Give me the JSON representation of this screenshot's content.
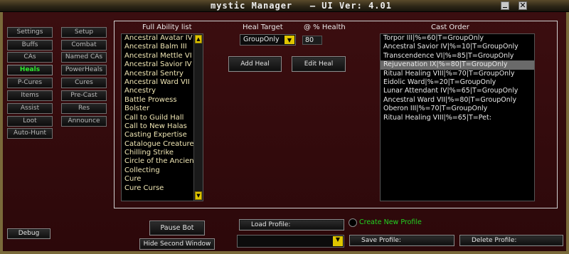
{
  "window": {
    "title": "mystic Manager   — UI Ver: 4.01",
    "close_glyph": "✕"
  },
  "sidebar": {
    "left": [
      {
        "label": "Settings",
        "active": false
      },
      {
        "label": "Buffs",
        "active": false
      },
      {
        "label": "CAs",
        "active": false
      },
      {
        "label": "Heals",
        "active": true
      },
      {
        "label": "P-Cures",
        "active": false
      },
      {
        "label": "Items",
        "active": false
      },
      {
        "label": "Assist",
        "active": false
      },
      {
        "label": "Loot",
        "active": false
      },
      {
        "label": "Auto-Hunt",
        "active": false
      }
    ],
    "right": [
      {
        "label": "Setup"
      },
      {
        "label": "Combat"
      },
      {
        "label": "Named CAs"
      },
      {
        "label": "PowerHeals"
      },
      {
        "label": "Cures"
      },
      {
        "label": "Pre-Cast"
      },
      {
        "label": "Res"
      },
      {
        "label": "Announce"
      }
    ]
  },
  "ability_list": {
    "header": "Full Ability list",
    "items": [
      "Ancestral Avatar IV",
      "Ancestral Balm III",
      "Ancestral Mettle VI",
      "Ancestral Savior IV",
      "Ancestral Sentry",
      "Ancestral Ward VII",
      "Ancestry",
      "Battle Prowess",
      "Bolster",
      "Call to Guild Hall",
      "Call to New Halas",
      "Casting Expertise",
      "Catalogue Creature",
      "Chilling Strike",
      "Circle of the Ancient",
      "Collecting",
      "Cure",
      "Cure Curse"
    ]
  },
  "heal_target": {
    "header": "Heal Target",
    "value": "GroupOnly"
  },
  "health": {
    "header": "@ % Health",
    "value": "80"
  },
  "buttons": {
    "add_heal": "Add Heal",
    "edit_heal": "Edit Heal",
    "debug": "Debug",
    "pause_bot": "Pause Bot",
    "hide_second_window": "Hide Second Window",
    "load_profile": "Load Profile:",
    "save_profile": "Save Profile:",
    "delete_profile": "Delete Profile:"
  },
  "create_new_profile": {
    "label": "Create New Profile",
    "color": "#22d422"
  },
  "cast_order": {
    "header": "Cast Order",
    "selected_index": 3,
    "items": [
      "Torpor III|%=60|T=GroupOnly",
      "Ancestral Savior IV|%=10|T=GroupOnly",
      "Transcendence VI|%=85|T=GroupOnly",
      "Rejuvenation IX|%=80|T=GroupOnly",
      "Ritual Healing VIII|%=70|T=GroupOnly",
      "Eidolic Ward|%=20|T=GroupOnly",
      "Lunar Attendant IV|%=65|T=GroupOnly",
      "Ancestral Ward VII|%=80|T=GroupOnly",
      "Oberon III|%=70|T=GroupOnly",
      "Ritual Healing VIII|%=65|T=Pet:"
    ]
  },
  "profile_dropdown": {
    "value": ""
  },
  "colors": {
    "background": "#2a0a0a",
    "frame_gold": "#7a6a3a",
    "active_tab": "#2eea2e",
    "scroll_arrow": "#e0c600",
    "ability_text": "#f0e6b4"
  }
}
